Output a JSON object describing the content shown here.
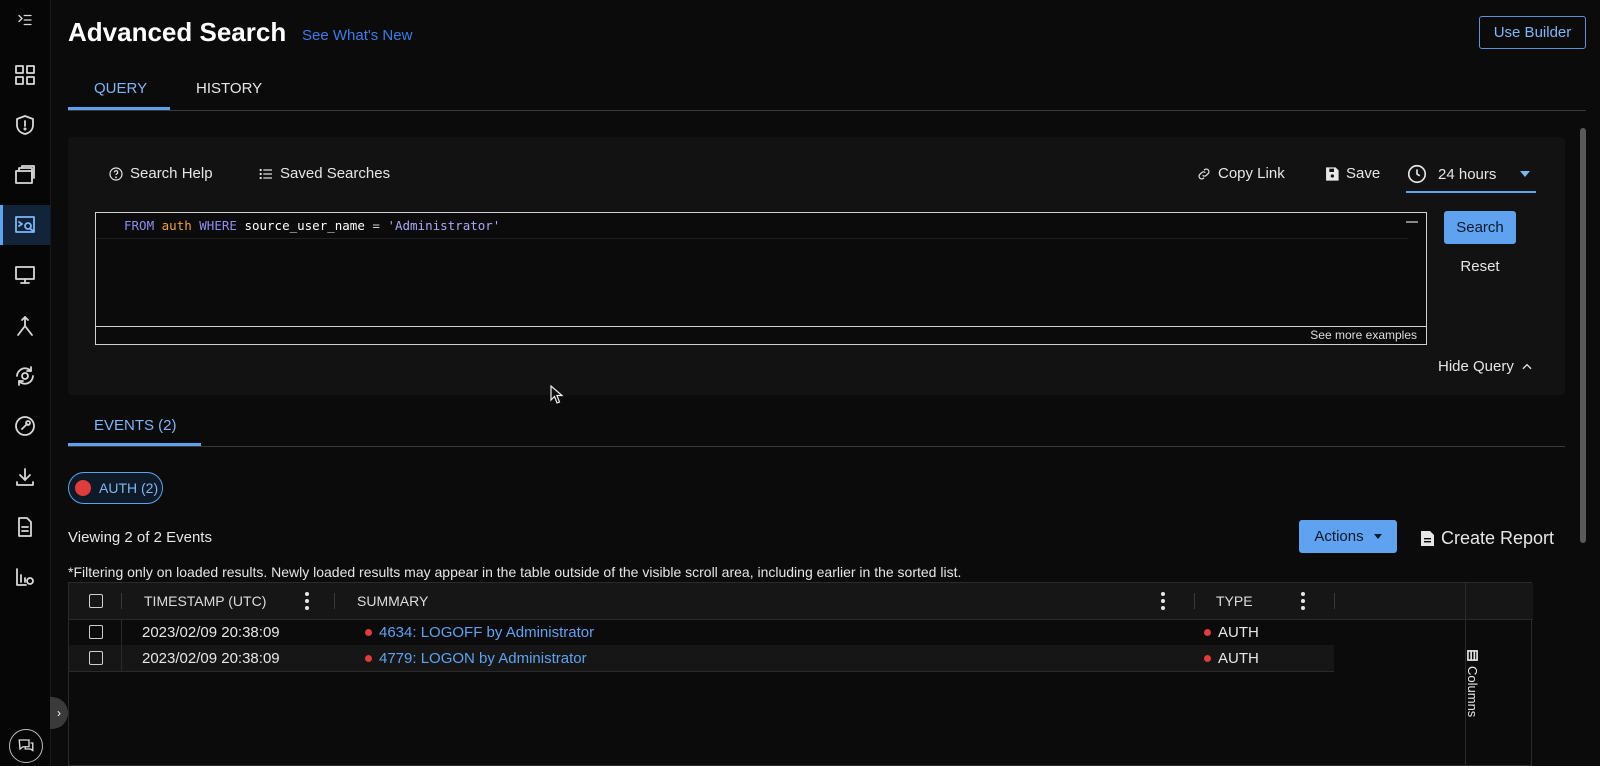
{
  "header": {
    "title": "Advanced Search",
    "whats_new": "See What's New",
    "use_builder": "Use Builder"
  },
  "tabs": [
    {
      "label": "QUERY",
      "active": true
    },
    {
      "label": "HISTORY",
      "active": false
    }
  ],
  "query_toolbar": {
    "search_help": "Search Help",
    "saved_searches": "Saved Searches",
    "copy_link": "Copy Link",
    "save": "Save",
    "time_range": "24 hours"
  },
  "query": {
    "tokens": [
      {
        "text": "FROM",
        "role": "keyword"
      },
      {
        "text": " ",
        "role": "space"
      },
      {
        "text": "auth",
        "role": "table"
      },
      {
        "text": " ",
        "role": "space"
      },
      {
        "text": "WHERE",
        "role": "keyword"
      },
      {
        "text": " ",
        "role": "space"
      },
      {
        "text": "source_user_name",
        "role": "field"
      },
      {
        "text": " = ",
        "role": "operator"
      },
      {
        "text": "'Administrator'",
        "role": "string"
      }
    ],
    "see_more": "See more examples",
    "search_button": "Search",
    "reset_button": "Reset",
    "hide_query": "Hide Query"
  },
  "events": {
    "tab_label": "EVENTS (2)",
    "chip_label": "AUTH (2)",
    "chip_color": "#e23b3b",
    "viewing": "Viewing 2 of 2 Events",
    "actions": "Actions",
    "create_report": "Create Report",
    "filter_note": "*Filtering only on loaded results.  Newly loaded results may appear in the table outside of the visible scroll area, including earlier in the sorted list.",
    "columns": [
      "TIMESTAMP (UTC)",
      "SUMMARY",
      "TYPE"
    ],
    "rows": [
      {
        "timestamp": "2023/02/09 20:38:09",
        "summary": "4634: LOGOFF by Administrator",
        "type": "AUTH"
      },
      {
        "timestamp": "2023/02/09 20:38:09",
        "summary": "4779: LOGON by Administrator",
        "type": "AUTH"
      }
    ],
    "columns_button": "Columns"
  },
  "sidebar": {
    "icons": [
      "collapse-menu-icon",
      "dashboard-icon",
      "shield-icon",
      "briefcase-icon",
      "log-search-icon",
      "monitor-icon",
      "merge-icon",
      "automation-icon",
      "tools-icon",
      "download-icon",
      "document-icon",
      "settings-report-icon"
    ],
    "active": "log-search-icon"
  },
  "colors": {
    "accent": "#5ea2f0",
    "link": "#3d7be8",
    "background": "#0b0b0b",
    "alert": "#e23b3b"
  }
}
